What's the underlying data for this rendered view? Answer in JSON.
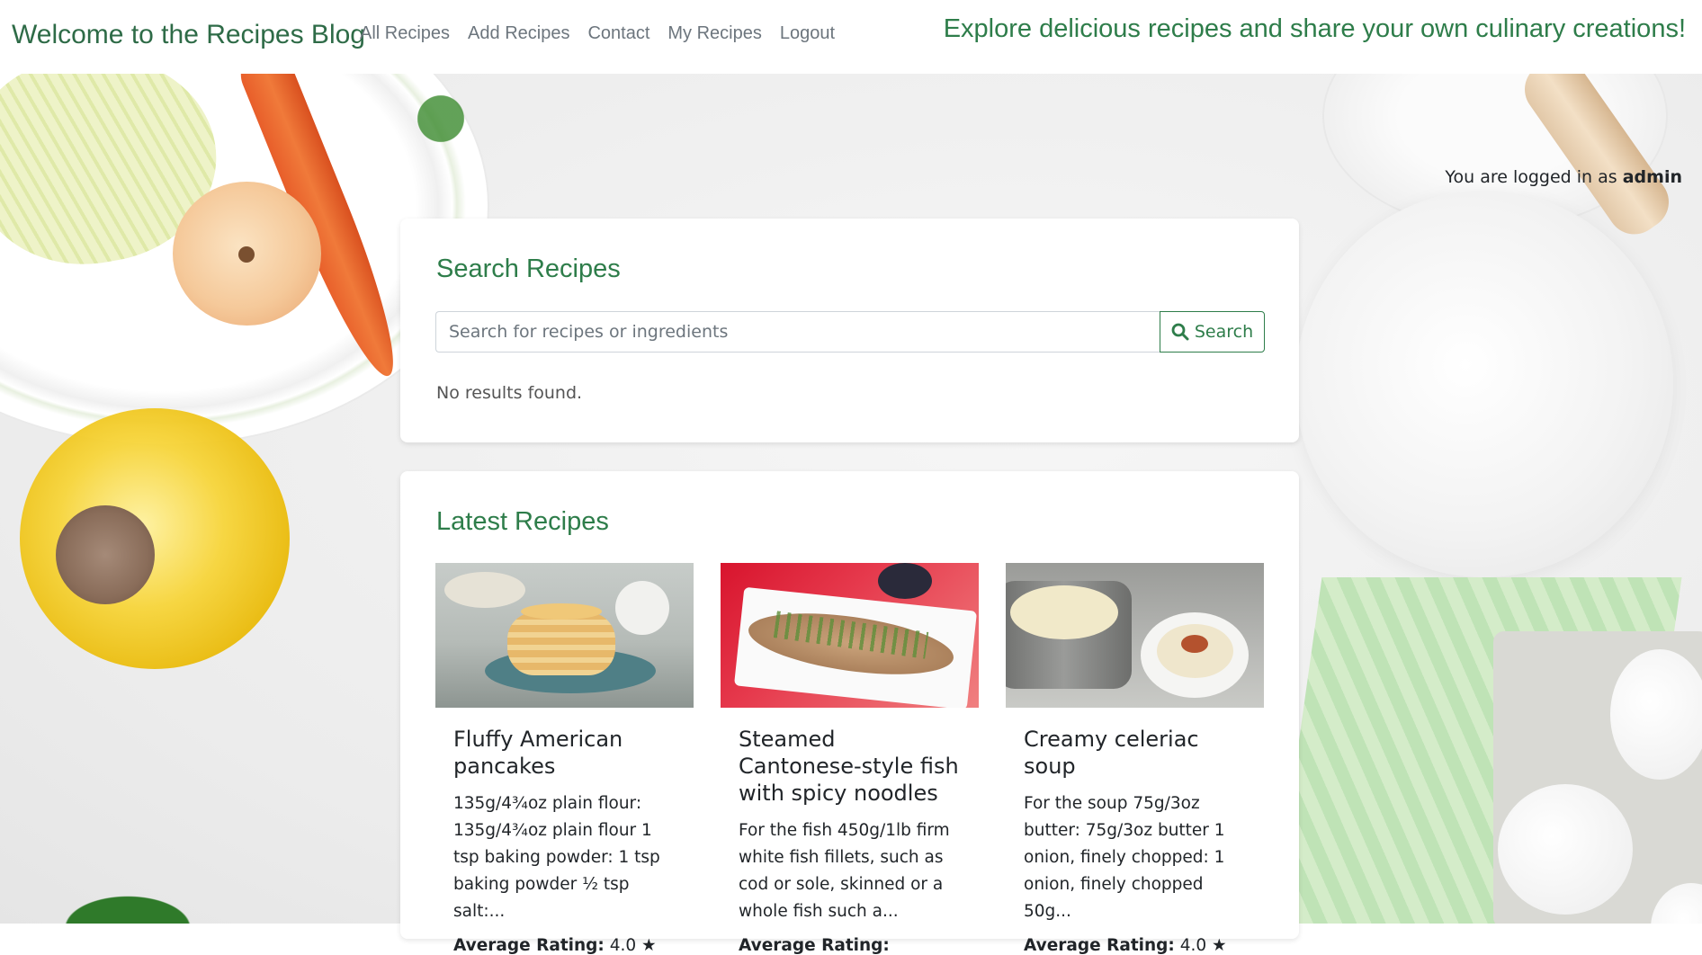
{
  "navbar": {
    "brand": "Welcome to the Recipes Blog",
    "links": [
      "All Recipes",
      "Add Recipes",
      "Contact",
      "My Recipes",
      "Logout"
    ],
    "tagline": "Explore delicious recipes and share your own culinary creations!"
  },
  "session": {
    "prefix": "You are logged in as",
    "username": "admin"
  },
  "search": {
    "title": "Search Recipes",
    "placeholder": "Search for recipes or ingredients",
    "value": "",
    "button_label": "Search",
    "button_icon": "search-icon",
    "result_text": "No results found."
  },
  "latest": {
    "title": "Latest Recipes",
    "recipes": [
      {
        "title": "Fluffy American pancakes",
        "description": "135g/4¾oz plain flour: 135g/4¾oz plain flour 1 tsp baking powder: 1 tsp baking powder ½ tsp salt:...",
        "rating_label": "Average Rating:",
        "rating_value": "4.0 ★"
      },
      {
        "title": "Steamed Cantonese-style fish with spicy noodles",
        "description": "For the fish 450g/1lb firm white fish fillets, such as cod or sole, skinned or a whole fish such a...",
        "rating_label": "Average Rating:",
        "rating_value": ""
      },
      {
        "title": "Creamy celeriac soup",
        "description": "For the soup 75g/3oz butter: 75g/3oz butter 1 onion, finely chopped: 1 onion, finely chopped 50g...",
        "rating_label": "Average Rating:",
        "rating_value": "4.0 ★"
      }
    ]
  },
  "colors": {
    "brand_green": "#2e6b47",
    "accent_green": "#2e7d4a",
    "nav_gray": "#6c757d"
  }
}
